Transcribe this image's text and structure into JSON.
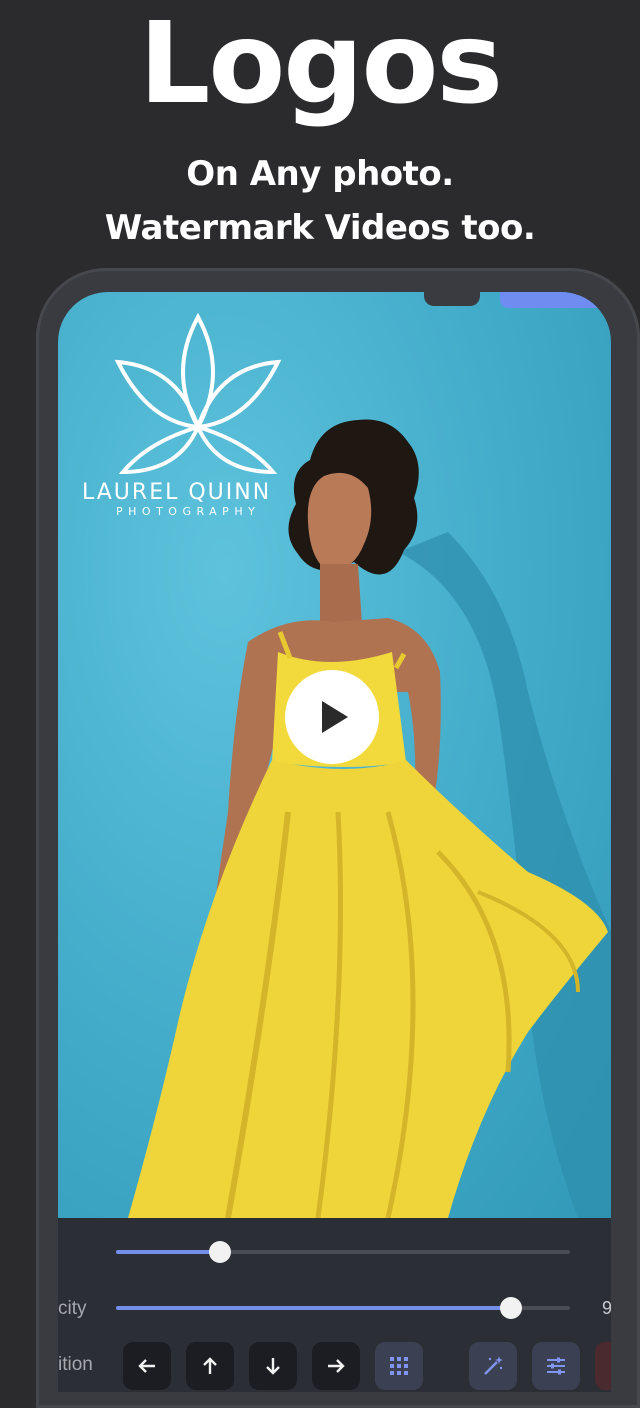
{
  "hero": {
    "title": "Logos",
    "line1": "On Any photo.",
    "line2": "Watermark Videos too."
  },
  "watermark": {
    "name": "LAUREL QUINN",
    "tagline": "PHOTOGRAPHY"
  },
  "controls": {
    "slider1": {
      "value_fraction": 0.23
    },
    "opacity": {
      "label": "city",
      "value_fraction": 0.87,
      "value_text": "9"
    },
    "position": {
      "label": "ition"
    }
  },
  "icons": {
    "play": "play-icon",
    "left": "arrow-left-icon",
    "up": "arrow-up-icon",
    "down": "arrow-down-icon",
    "right": "arrow-right-icon",
    "grid": "grid-icon",
    "magic": "magic-wand-icon",
    "sliders": "sliders-icon"
  },
  "colors": {
    "background": "#2b2a2c",
    "accent": "#7390ea",
    "wall": "#41abc9",
    "dress": "#f0d53a"
  }
}
